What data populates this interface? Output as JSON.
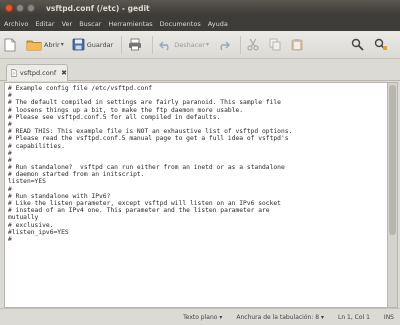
{
  "window": {
    "title": "vsftpd.conf (/etc) - gedit"
  },
  "menu": {
    "items": [
      "Archivo",
      "Editar",
      "Ver",
      "Buscar",
      "Herramientas",
      "Documentos",
      "Ayuda"
    ]
  },
  "toolbar": {
    "open_label": "Abrir",
    "save_label": "Guardar",
    "undo_label": "Deshacer"
  },
  "tab": {
    "label": "vsftpd.conf"
  },
  "editor": {
    "lines": [
      "# Example config file /etc/vsftpd.conf",
      "#",
      "# The default compiled in settings are fairly paranoid. This sample file",
      "# loosens things up a bit, to make the ftp daemon more usable.",
      "# Please see vsftpd.conf.5 for all compiled in defaults.",
      "#",
      "# READ THIS: This example file is NOT an exhaustive list of vsftpd options.",
      "# Please read the vsftpd.conf.5 manual page to get a full idea of vsftpd's",
      "# capabilities.",
      "#",
      "#",
      "# Run standalone?  vsftpd can run either from an inetd or as a standalone",
      "# daemon started from an initscript.",
      "listen=YES",
      "#",
      "# Run standalone with IPv6?",
      "# Like the listen parameter, except vsftpd will listen on an IPv6 socket",
      "# instead of an IPv4 one. This parameter and the listen parameter are",
      "mutually",
      "# exclusive.",
      "#listen_ipv6=YES",
      "#"
    ]
  },
  "status": {
    "language": "Texto plano",
    "tab_width": "Anchura de la tabulación: 8",
    "position": "Ln 1, Col 1",
    "mode": "INS"
  }
}
